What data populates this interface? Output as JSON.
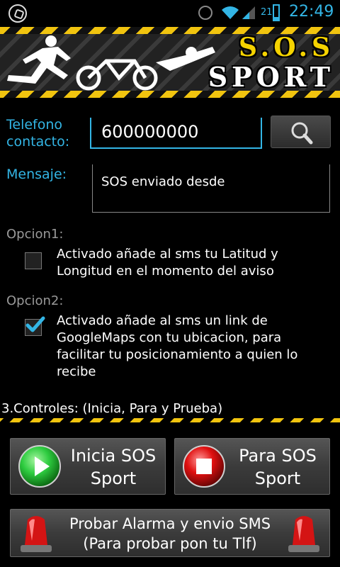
{
  "status_bar": {
    "battery_level": "21",
    "time": "22:49",
    "icons": [
      "whatsapp-icon",
      "alarm-clock-icon",
      "wifi-icon",
      "signal-icon",
      "battery-icon"
    ]
  },
  "banner": {
    "title_line1": "S.O.S",
    "title_line2": "SPORT"
  },
  "form": {
    "phone_label": "Telefono contacto:",
    "phone_value": "600000000",
    "message_label": "Mensaje:",
    "message_value": "SOS enviado desde"
  },
  "options": {
    "option1": {
      "title": "Opcion1:",
      "text": "Activado añade al sms tu Latitud y Longitud en el momento del aviso",
      "checked": false
    },
    "option2": {
      "title": "Opcion2:",
      "text": "Activado añade al sms un link de GoogleMaps con tu ubicacion, para facilitar tu posicionamiento a quien lo recibe",
      "checked": true
    }
  },
  "controls": {
    "section_title": "3.Controles: (Inicia, Para y Prueba)",
    "start_label_1": "Inicia SOS",
    "start_label_2": "Sport",
    "stop_label_1": "Para SOS",
    "stop_label_2": "Sport",
    "test_label_1": "Probar Alarma y envio SMS",
    "test_label_2": "(Para probar pon tu Tlf)"
  },
  "colors": {
    "accent": "#33b5e5",
    "hazard_yellow": "#f1c40f",
    "start_green": "#2ecc40",
    "stop_red": "#e01010"
  }
}
